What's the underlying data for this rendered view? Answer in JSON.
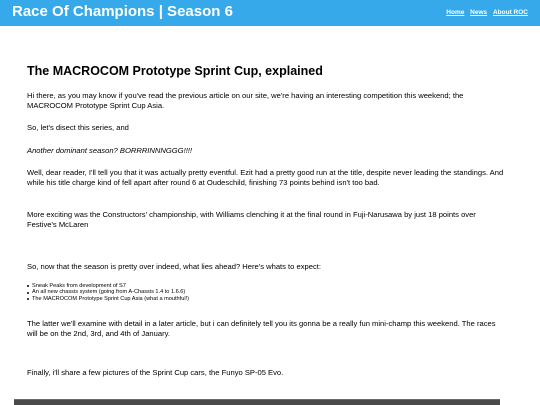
{
  "header": {
    "site_title": "Race Of Champions | Season 6",
    "nav": [
      "Home",
      "News",
      "About ROC"
    ]
  },
  "colors": {
    "header_background": "#35a9ea",
    "header_text": "#ffffff",
    "body_text": "#000000"
  },
  "article": {
    "title": "The MACROCOM Prototype Sprint Cup, explained",
    "paragraphs": [
      "Hi there, as you may know if you've read the previous article on our site, we're having an interesting competition this weekend; the MACROCOM Prototype Sprint Cup Asia.",
      "So, let's disect this series, and",
      "Another dominant season? BORRRINNNGGG!!!!",
      "Well, dear reader, I'll tell you that it was actually pretty eventful. Ezit had a pretty good run at the title, despite never leading the standings. And while his title charge kind of fell apart after round 6 at Oudeschild, finishing 73 points behind isn't too bad.",
      "More exciting was the Constructors' championship, with Williams clenching it at the final round in Fuji-Narusawa by just 18 points over Festive's McLaren",
      "So, now that the season is pretty over indeed, what lies ahead? Here's whats to expect:",
      "The latter we'll examine with detail in a later article, but i can definitely tell you its gonna be a really fun mini-champ this weekend. The races will be on the 2nd, 3rd, and 4th of January.",
      "Finally, i'll share a few pictures of the Sprint Cup cars, the Funyo SP-05 Evo."
    ],
    "bullets": [
      "Sneak Peaks from development of S7",
      "An all new chassis system (going from A-Chassis 1.4 to 1.6.6)",
      "The MACROCOM Prototype Sprint Cup Asia (what a mouthful!)"
    ]
  }
}
